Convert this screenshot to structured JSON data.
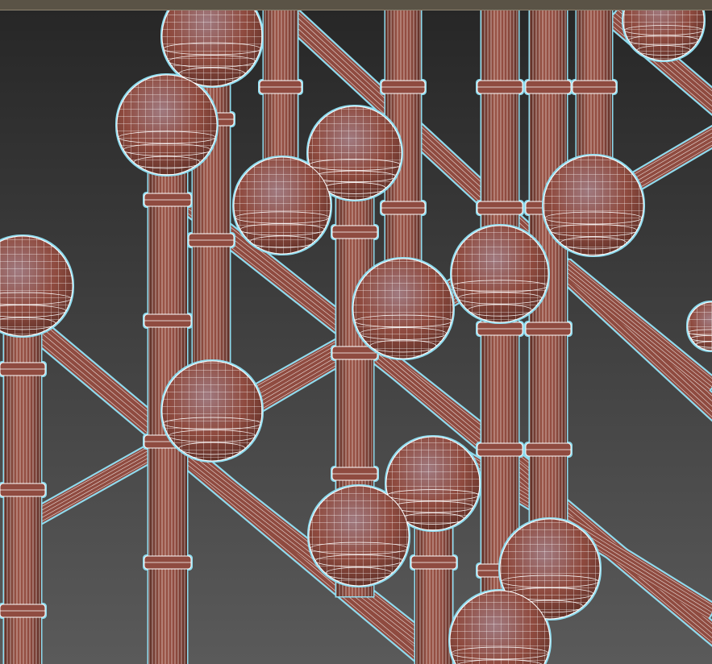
{
  "viewport": {
    "render_mode": "shaded-with-edged-faces",
    "selection_state": "selected",
    "colors": {
      "background_top": "#272727",
      "background_bottom": "#5a5a5a",
      "frame_bar": "#5a5346",
      "frame_bar_edge": "#8c8270",
      "material": "#8f4b3f",
      "material_highlight": "#9a6a6e",
      "material_shadow": "#5c2e26",
      "wire": "#ffffff",
      "selection_glow": "#8fdcef"
    }
  },
  "model": {
    "description_icon": "ball-and-rod-lattice",
    "component_types": [
      "sphere",
      "vertical-rod",
      "diagonal-strut",
      "ring-collar"
    ]
  }
}
